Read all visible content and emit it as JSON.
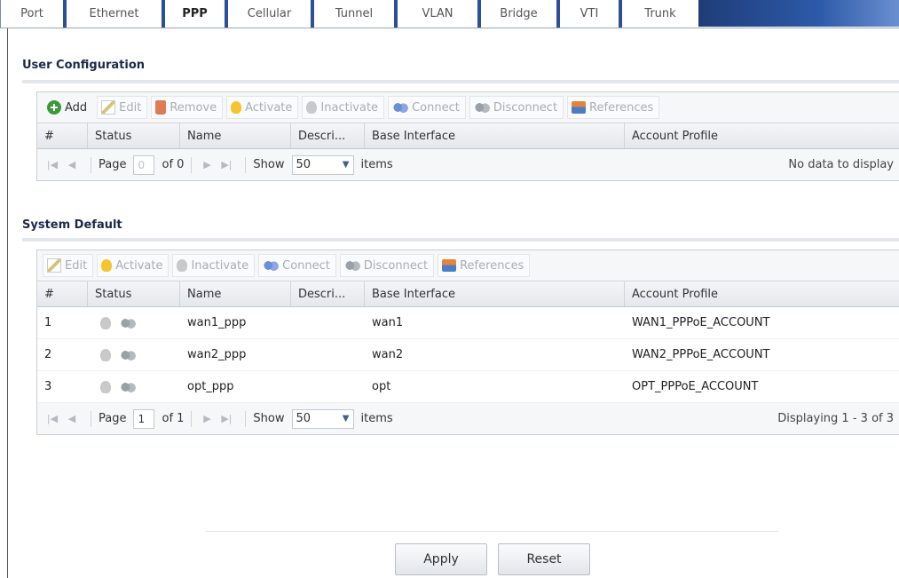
{
  "tabs": [
    {
      "label": "Port",
      "active": false
    },
    {
      "label": "Ethernet",
      "active": false
    },
    {
      "label": "PPP",
      "active": true
    },
    {
      "label": "Cellular",
      "active": false
    },
    {
      "label": "Tunnel",
      "active": false
    },
    {
      "label": "VLAN",
      "active": false
    },
    {
      "label": "Bridge",
      "active": false
    },
    {
      "label": "VTI",
      "active": false
    },
    {
      "label": "Trunk",
      "active": false
    }
  ],
  "user_config": {
    "title": "User Configuration",
    "toolbar": {
      "add": "Add",
      "edit": "Edit",
      "remove": "Remove",
      "activate": "Activate",
      "inactivate": "Inactivate",
      "connect": "Connect",
      "disconnect": "Disconnect",
      "references": "References"
    },
    "columns": [
      "#",
      "Status",
      "Name",
      "Descri...",
      "Base Interface",
      "Account Profile"
    ],
    "pager": {
      "page_label": "Page",
      "page_value": "0",
      "of_label": "of 0",
      "show_label": "Show",
      "show_value": "50",
      "items_label": "items",
      "status": "No data to display"
    }
  },
  "system_default": {
    "title": "System Default",
    "toolbar": {
      "edit": "Edit",
      "activate": "Activate",
      "inactivate": "Inactivate",
      "connect": "Connect",
      "disconnect": "Disconnect",
      "references": "References"
    },
    "columns": [
      "#",
      "Status",
      "Name",
      "Descri...",
      "Base Interface",
      "Account Profile"
    ],
    "rows": [
      {
        "num": "1",
        "name": "wan1_ppp",
        "desc": "",
        "base": "wan1",
        "profile": "WAN1_PPPoE_ACCOUNT"
      },
      {
        "num": "2",
        "name": "wan2_ppp",
        "desc": "",
        "base": "wan2",
        "profile": "WAN2_PPPoE_ACCOUNT"
      },
      {
        "num": "3",
        "name": "opt_ppp",
        "desc": "",
        "base": "opt",
        "profile": "OPT_PPPoE_ACCOUNT"
      }
    ],
    "pager": {
      "page_label": "Page",
      "page_value": "1",
      "of_label": "of 1",
      "show_label": "Show",
      "show_value": "50",
      "items_label": "items",
      "status": "Displaying 1 - 3 of 3"
    }
  },
  "buttons": {
    "apply": "Apply",
    "reset": "Reset"
  }
}
